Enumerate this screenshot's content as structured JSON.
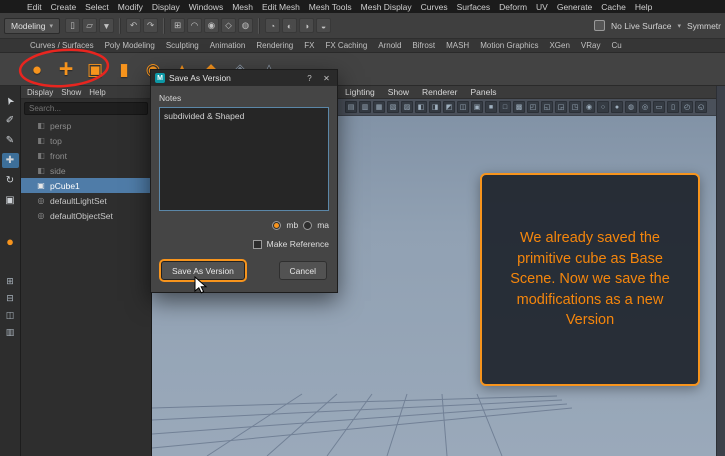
{
  "menubar": {
    "items": [
      "Edit",
      "Create",
      "Select",
      "Modify",
      "Display",
      "Windows",
      "Mesh",
      "Edit Mesh",
      "Mesh Tools",
      "Mesh Display",
      "Curves",
      "Surfaces",
      "Deform",
      "UV",
      "Generate",
      "Cache",
      "Help"
    ]
  },
  "statusline": {
    "mode_label": "Modeling",
    "caret": "▾",
    "live_surface_label": "No Live Surface",
    "symmetry_label": "Symmetr",
    "icons": [
      {
        "name": "new-scene-icon",
        "glyph": "▯"
      },
      {
        "name": "open-scene-icon",
        "glyph": "▱"
      },
      {
        "name": "save-scene-icon",
        "glyph": "▼"
      },
      {
        "name": "separator",
        "sep": true
      },
      {
        "name": "undo-icon",
        "glyph": "↶"
      },
      {
        "name": "redo-icon",
        "glyph": "↷"
      },
      {
        "name": "separator",
        "sep": true
      },
      {
        "name": "snap-grid-icon",
        "glyph": "⊞"
      },
      {
        "name": "snap-curve-icon",
        "glyph": "◠"
      },
      {
        "name": "snap-point-icon",
        "glyph": "◉"
      },
      {
        "name": "snap-view-plane-icon",
        "glyph": "◇"
      },
      {
        "name": "make-live-icon",
        "glyph": "◍"
      },
      {
        "name": "separator",
        "sep": true
      },
      {
        "name": "construction-history-icon",
        "glyph": "◔"
      },
      {
        "name": "render-icon",
        "glyph": "◐"
      },
      {
        "name": "ipr-render-icon",
        "glyph": "◑"
      },
      {
        "name": "render-settings-icon",
        "glyph": "◒"
      }
    ]
  },
  "shelf": {
    "tabs": [
      "Curves / Surfaces",
      "Poly Modeling",
      "Sculpting",
      "Animation",
      "Rendering",
      "FX",
      "FX Caching",
      "Arnold",
      "Bifrost",
      "MASH",
      "Motion Graphics",
      "XGen",
      "VRay",
      "Cu"
    ],
    "icons": [
      {
        "name": "poly-sphere-icon",
        "glyph": "●"
      },
      {
        "name": "add-icon",
        "glyph": "+",
        "big": true
      },
      {
        "name": "poly-cube-icon",
        "glyph": "▣"
      },
      {
        "name": "poly-cylinder-icon",
        "glyph": "▮"
      },
      {
        "name": "poly-sphere-alt-icon",
        "glyph": "◉"
      },
      {
        "name": "poly-cone-icon",
        "glyph": "▲"
      },
      {
        "name": "poly-plane-icon",
        "glyph": "◆"
      },
      {
        "name": "shelf-extra-icon",
        "glyph": "◈",
        "dim": true
      },
      {
        "name": "shelf-extra2-icon",
        "glyph": "◬",
        "dim": true
      }
    ]
  },
  "toolbox": {
    "tools": [
      {
        "name": "select-tool-icon",
        "glyph": "➤",
        "rot": true
      },
      {
        "name": "lasso-tool-icon",
        "glyph": "✐"
      },
      {
        "name": "paint-select-tool-icon",
        "glyph": "✎"
      },
      {
        "name": "move-tool-icon",
        "glyph": "✚",
        "selected": true
      },
      {
        "name": "rotate-tool-icon",
        "glyph": "↻"
      },
      {
        "name": "scale-tool-icon",
        "glyph": "▣"
      },
      {
        "name": "separator",
        "sep": true
      },
      {
        "name": "last-tool-icon",
        "glyph": "●",
        "accent": true
      },
      {
        "name": "separator",
        "sep": true
      },
      {
        "name": "layout-single-pane-icon",
        "glyph": "⊞",
        "small": true
      },
      {
        "name": "layout-four-pane-icon",
        "glyph": "⊟",
        "small": true
      },
      {
        "name": "layout-split-pane-icon",
        "glyph": "◫",
        "small": true
      },
      {
        "name": "layout-outliner-icon",
        "glyph": "▥",
        "small": true
      }
    ]
  },
  "outliner": {
    "menus": [
      "Display",
      "Show",
      "Help"
    ],
    "search_placeholder": "Search...",
    "items": [
      {
        "label": "persp",
        "icon": "◧",
        "dim": true
      },
      {
        "label": "top",
        "icon": "◧",
        "dim": true
      },
      {
        "label": "front",
        "icon": "◧",
        "dim": true
      },
      {
        "label": "side",
        "icon": "◧",
        "dim": true
      },
      {
        "label": "pCube1",
        "icon": "▣",
        "selected": true
      },
      {
        "label": "defaultLightSet",
        "icon": "◎"
      },
      {
        "label": "defaultObjectSet",
        "icon": "◎"
      }
    ]
  },
  "viewport": {
    "menus": [
      "Lighting",
      "Show",
      "Renderer",
      "Panels"
    ],
    "icons": [
      {
        "glyph": "▤"
      },
      {
        "glyph": "▥"
      },
      {
        "glyph": "▦"
      },
      {
        "glyph": "▧"
      },
      {
        "glyph": "▨"
      },
      {
        "glyph": "◧"
      },
      {
        "glyph": "◨"
      },
      {
        "glyph": "◩"
      },
      {
        "glyph": "◫"
      },
      {
        "glyph": "▣"
      },
      {
        "glyph": "■"
      },
      {
        "glyph": "□"
      },
      {
        "glyph": "▩"
      },
      {
        "glyph": "◰"
      },
      {
        "glyph": "◱"
      },
      {
        "glyph": "◲"
      },
      {
        "glyph": "◳"
      },
      {
        "glyph": "◉"
      },
      {
        "glyph": "○"
      },
      {
        "glyph": "●"
      },
      {
        "glyph": "◍"
      },
      {
        "glyph": "◎"
      },
      {
        "glyph": "▭"
      },
      {
        "glyph": "▯"
      },
      {
        "glyph": "◴"
      },
      {
        "glyph": "◵"
      }
    ]
  },
  "dialog": {
    "app_icon_glyph": "M",
    "title": "Save As Version",
    "help_glyph": "?",
    "close_glyph": "✕",
    "notes_label": "Notes",
    "notes_value": "subdivided & Shaped",
    "format_mb": "mb",
    "format_ma": "ma",
    "make_reference": "Make Reference",
    "save_label": "Save As Version",
    "cancel_label": "Cancel"
  },
  "callout": {
    "text": "We already saved the primitive cube as Base Scene. Now we save the modifications as a new Version"
  },
  "colors": {
    "accent": "#f7941d",
    "selection": "#4f7ca8",
    "annotation_red": "#e8251f"
  }
}
